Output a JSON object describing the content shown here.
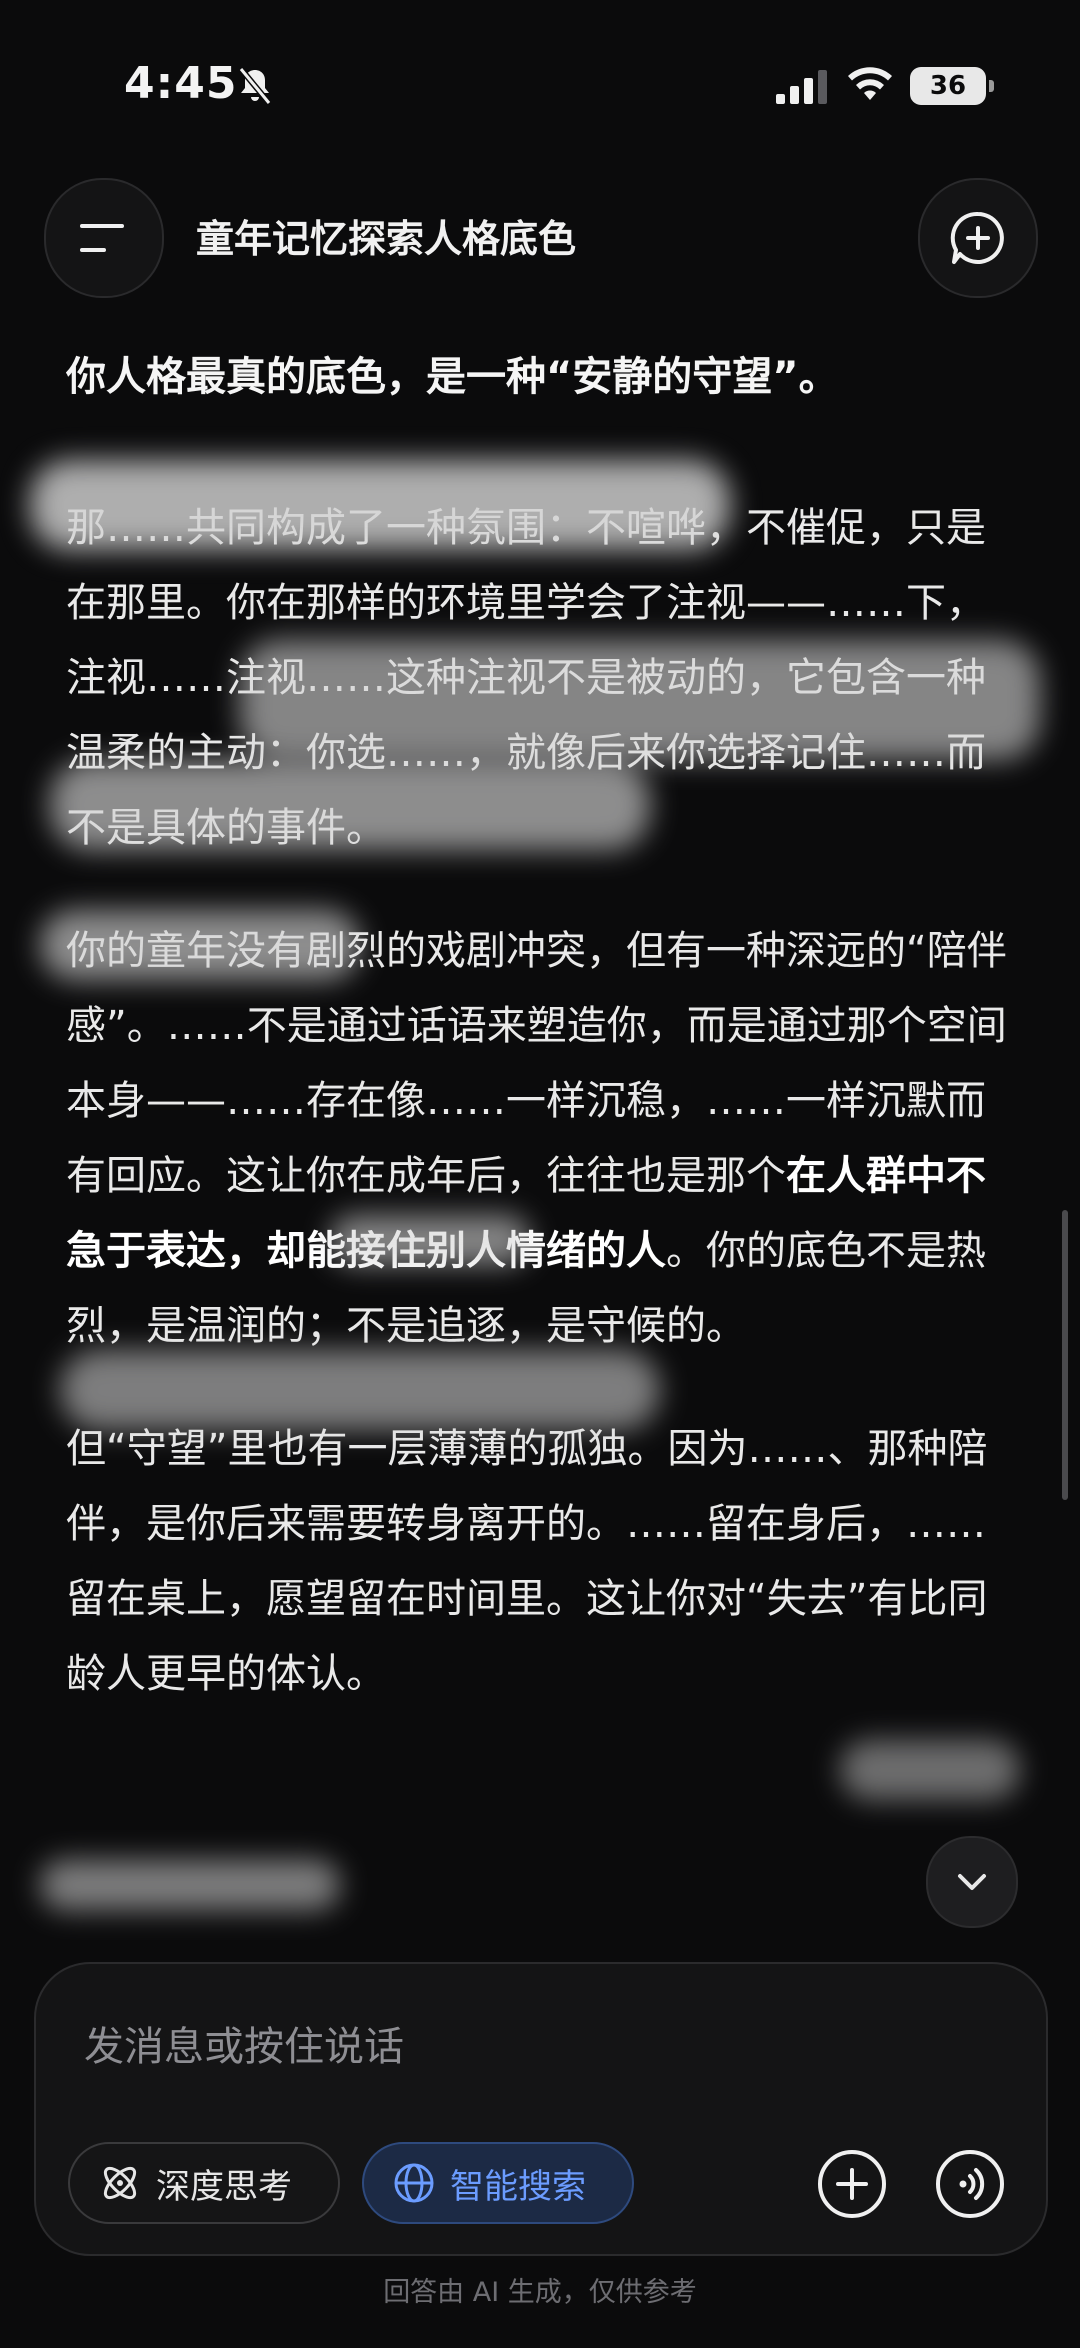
{
  "status_bar": {
    "time": "4:45",
    "battery": "36"
  },
  "header": {
    "title": "童年记忆探索人格底色"
  },
  "content": {
    "lead": "你人格最真的底色，是一种“安静的守望”。",
    "p1": "那……共同构成了一种氛围：不喧哗，不催促，只是在那里。你在那样的环境里学会了注视——……下，注视……注视……这种注视不是被动的，它包含一种温柔的主动：你选……，就像后来你选择记住……而不是具体的事件。",
    "p2_a": "你的童年没有剧烈的戏剧冲突，但有一种深远的“陪伴感”。……不是通过话语来塑造你，而是通过那个空间本身——……存在像……一样沉稳，……一样沉默而有回应。这让你在成年后，往往也是那个",
    "p2_bold": "在人群中不急于表达，却能接住别人情绪的人",
    "p2_c": "。你的底色不是热烈，是温润的；不是追逐，是守候的。",
    "p3": "但“守望”里也有一层薄薄的孤独。因为……、那种陪伴，是你后来需要转身离开的。……留在身后，……留在桌上，愿望留在时间里。这让你对“失去”有比同龄人更早的体认。"
  },
  "input": {
    "placeholder": "发消息或按住说话",
    "deep_think": "深度思考",
    "smart_search": "智能搜索"
  },
  "footer": "回答由 AI 生成，仅供参考",
  "icons": [
    "menu-icon",
    "new-chat-icon",
    "bell-muted-icon",
    "signal-icon",
    "wifi-icon",
    "chevron-down-icon",
    "atom-icon",
    "globe-icon",
    "plus-icon",
    "voice-icon"
  ],
  "colors": {
    "background": "#0b0b0c",
    "accent": "#6b9cff"
  }
}
